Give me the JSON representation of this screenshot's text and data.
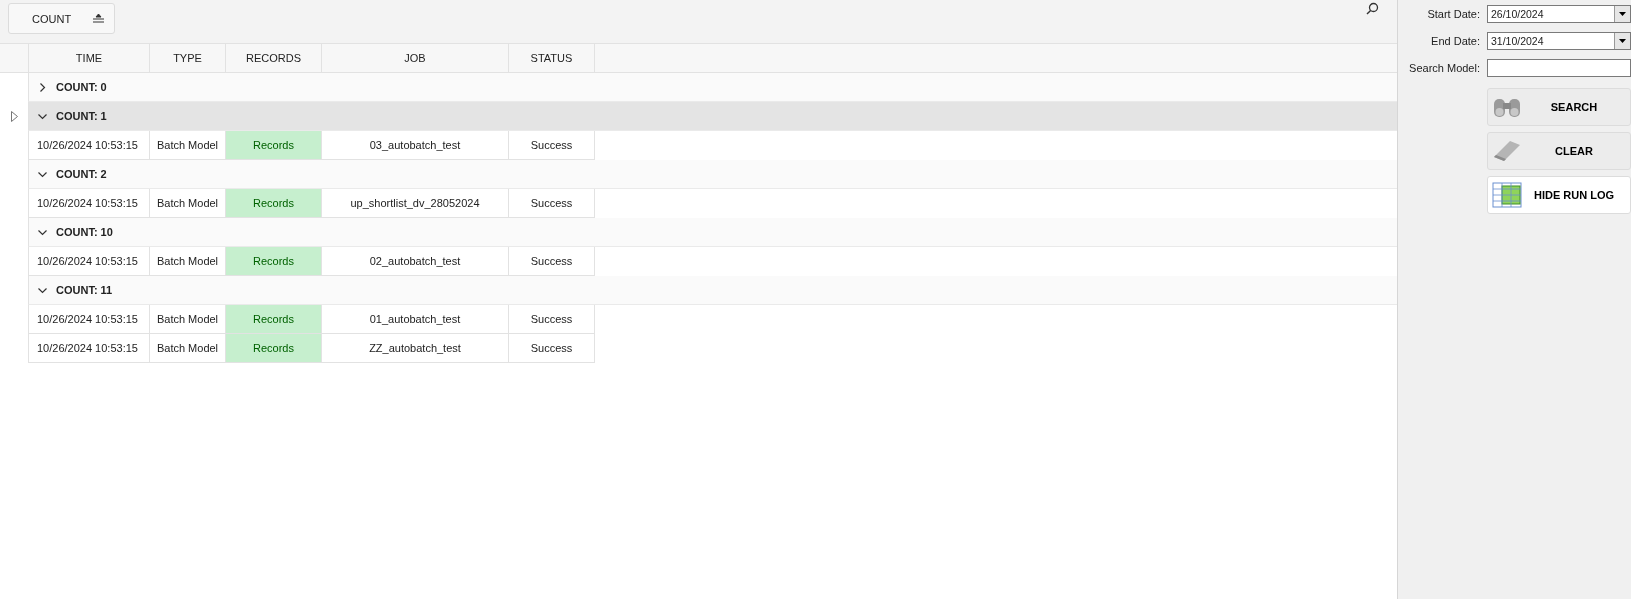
{
  "group_panel": {
    "chip": "COUNT"
  },
  "table": {
    "columns": [
      "TIME",
      "TYPE",
      "RECORDS",
      "JOB",
      "STATUS"
    ],
    "groups": [
      {
        "label": "COUNT: 0",
        "expanded": false,
        "selected": false
      },
      {
        "label": "COUNT: 1",
        "expanded": true,
        "selected": true,
        "rows": [
          {
            "time": "10/26/2024 10:53:15",
            "type": "Batch Model",
            "records": "Records",
            "job": "03_autobatch_test",
            "status": "Success"
          }
        ]
      },
      {
        "label": "COUNT: 2",
        "expanded": true,
        "selected": false,
        "rows": [
          {
            "time": "10/26/2024 10:53:15",
            "type": "Batch Model",
            "records": "Records",
            "job": "up_shortlist_dv_28052024",
            "status": "Success"
          }
        ]
      },
      {
        "label": "COUNT: 10",
        "expanded": true,
        "selected": false,
        "rows": [
          {
            "time": "10/26/2024 10:53:15",
            "type": "Batch Model",
            "records": "Records",
            "job": "02_autobatch_test",
            "status": "Success"
          }
        ]
      },
      {
        "label": "COUNT: 11",
        "expanded": true,
        "selected": false,
        "rows": [
          {
            "time": "10/26/2024 10:53:15",
            "type": "Batch Model",
            "records": "Records",
            "job": "01_autobatch_test",
            "status": "Success"
          },
          {
            "time": "10/26/2024 10:53:15",
            "type": "Batch Model",
            "records": "Records",
            "job": "ZZ_autobatch_test",
            "status": "Success"
          }
        ]
      }
    ]
  },
  "filters": {
    "start_label": "Start Date:",
    "start_value": "26/10/2024",
    "end_label": "End Date:",
    "end_value": "31/10/2024",
    "model_label": "Search Model:"
  },
  "buttons": [
    {
      "kind": "search",
      "label": "SEARCH"
    },
    {
      "kind": "clear",
      "label": "CLEAR"
    },
    {
      "kind": "grid",
      "label": "HIDE RUN LOG"
    }
  ]
}
